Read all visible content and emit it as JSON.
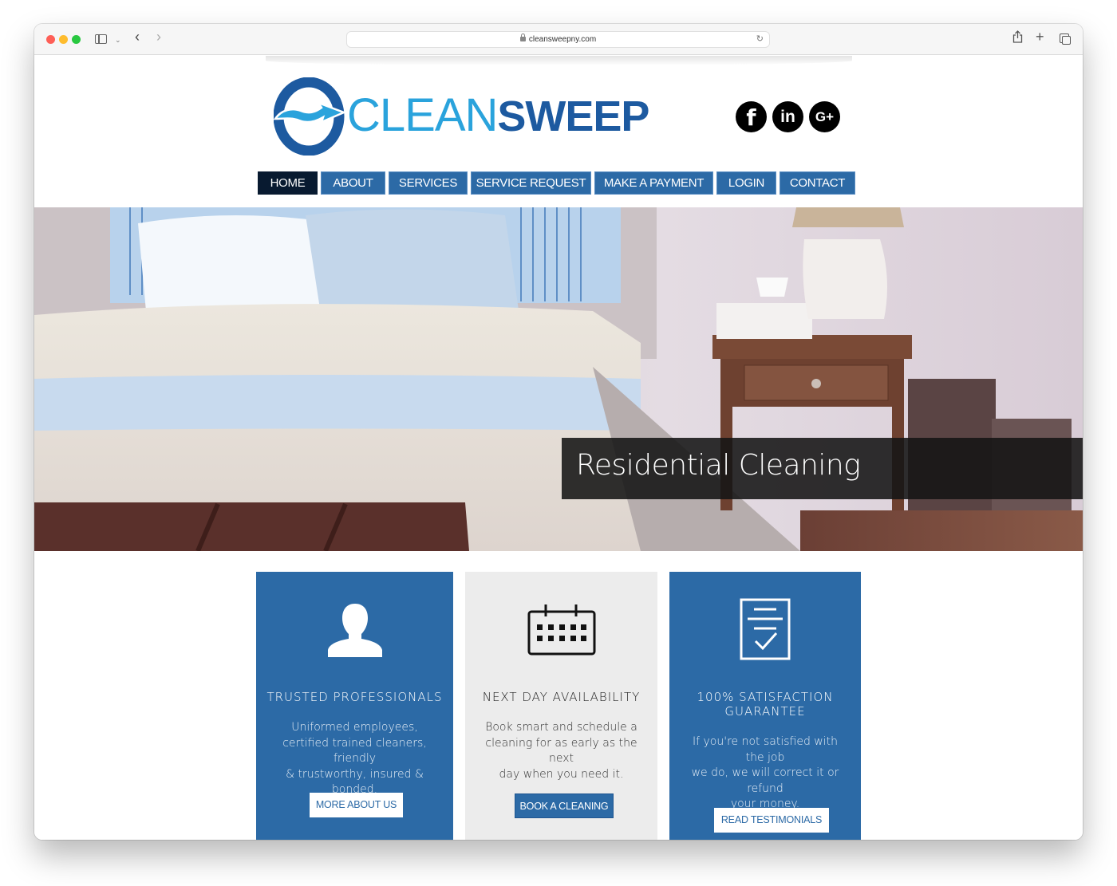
{
  "browser": {
    "url": "cleansweepny.com",
    "icons": {
      "close": "red-dot",
      "minimize": "yellow-dot",
      "zoom": "green-dot",
      "sidebar": "sidebar-icon",
      "back": "‹",
      "forward": "›",
      "reload": "↻",
      "share": "⇪",
      "new_tab": "+",
      "tabs": "tab-overview-icon"
    }
  },
  "header": {
    "logo_light": "CLEAN",
    "logo_dark": "SWEEP",
    "brand_colors": {
      "light": "#2aa3dc",
      "dark": "#1d5aa0"
    },
    "social": [
      {
        "name": "facebook",
        "glyph": "f"
      },
      {
        "name": "linkedin",
        "glyph": "in"
      },
      {
        "name": "google-plus",
        "glyph": "G+"
      }
    ]
  },
  "nav": {
    "items": [
      {
        "label": "HOME",
        "active": true
      },
      {
        "label": "ABOUT",
        "active": false
      },
      {
        "label": "SERVICES",
        "active": false
      },
      {
        "label": "SERVICE REQUEST",
        "active": false
      },
      {
        "label": "MAKE A PAYMENT",
        "active": false
      },
      {
        "label": "LOGIN",
        "active": false
      },
      {
        "label": "CONTACT",
        "active": false
      }
    ],
    "colors": {
      "default": "#2c6aa6",
      "active": "#081a30"
    }
  },
  "hero": {
    "caption": "Residential Cleaning"
  },
  "features": [
    {
      "icon": "person-icon",
      "title": "TRUSTED PROFESSIONALS",
      "body_lines": [
        "Uniformed employees,",
        "certified trained cleaners, friendly",
        "& trustworthy, insured & bonded."
      ],
      "button": "MORE ABOUT US"
    },
    {
      "icon": "calendar-icon",
      "title": "NEXT DAY AVAILABILITY",
      "body_lines": [
        "Book smart and schedule a",
        "cleaning for as early as the next",
        "day when you need it."
      ],
      "button": "BOOK A CLEANING"
    },
    {
      "icon": "checklist-icon",
      "title_lines": [
        "100% SATISFACTION",
        "GUARANTEE"
      ],
      "body_lines": [
        "If you're not satisfied with the job",
        "we do, we will correct it or refund",
        "your money."
      ],
      "button": "READ TESTIMONIALS"
    }
  ]
}
